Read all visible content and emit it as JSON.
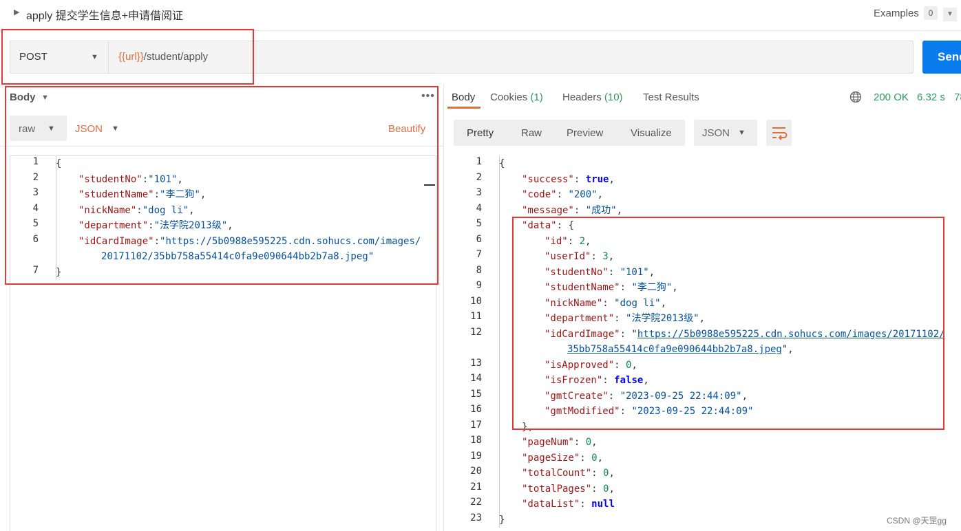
{
  "request": {
    "title": "apply 提交学生信息+申请借阅证",
    "examples_label": "Examples",
    "examples_count": "0",
    "method": "POST",
    "url_variable": "{{url}}",
    "url_path": "/student/apply",
    "send_label": "Send"
  },
  "body_panel": {
    "title": "Body",
    "mode": "raw",
    "format": "JSON",
    "beautify": "Beautify",
    "lines": [
      {
        "no": "1",
        "text": "{"
      },
      {
        "no": "2",
        "key": "\"studentNo\"",
        "sep": ":",
        "val": "\"101\"",
        "end": ","
      },
      {
        "no": "3",
        "key": "\"studentName\"",
        "sep": ":",
        "val": "\"李二狗\"",
        "end": ","
      },
      {
        "no": "4",
        "key": "\"nickName\"",
        "sep": ":",
        "val": "\"dog li\"",
        "end": ","
      },
      {
        "no": "5",
        "key": "\"department\"",
        "sep": ":",
        "val": "\"法学院2013级\"",
        "end": ","
      },
      {
        "no": "6",
        "key": "\"idCardImage\"",
        "sep": ":",
        "val": "\"https://5b0988e595225.cdn.sohucs.com/images/",
        "cont": "20171102/35bb758a55414c0fa9e090644bb2b7a8.jpeg\""
      },
      {
        "no": "7",
        "text": "}"
      }
    ]
  },
  "response": {
    "tabs": {
      "body": "Body",
      "cookies": "Cookies",
      "cookies_count": "(1)",
      "headers": "Headers",
      "headers_count": "(10)",
      "tests": "Test Results"
    },
    "status": "200 OK",
    "time": "6.32 s",
    "size_partial": "78",
    "view_tabs": [
      "Pretty",
      "Raw",
      "Preview",
      "Visualize"
    ],
    "format": "JSON",
    "line_numbers": [
      "1",
      "2",
      "3",
      "4",
      "5",
      "6",
      "7",
      "8",
      "9",
      "10",
      "11",
      "12",
      "13",
      "14",
      "15",
      "16",
      "17",
      "18",
      "19",
      "20",
      "21",
      "22",
      "23"
    ],
    "json": {
      "open": "{",
      "success_key": "\"success\"",
      "success_val": "true",
      "code_key": "\"code\"",
      "code_val": "\"200\"",
      "message_key": "\"message\"",
      "message_val": "\"成功\"",
      "data_key": "\"data\"",
      "data_open": "{",
      "id_key": "\"id\"",
      "id_val": "2",
      "userId_key": "\"userId\"",
      "userId_val": "3",
      "studentNo_key": "\"studentNo\"",
      "studentNo_val": "\"101\"",
      "studentName_key": "\"studentName\"",
      "studentName_val": "\"李二狗\"",
      "nickName_key": "\"nickName\"",
      "nickName_val": "\"dog li\"",
      "department_key": "\"department\"",
      "department_val": "\"法学院2013级\"",
      "idCardImage_key": "\"idCardImage\"",
      "idCardImage_link1": "https://5b0988e595225.cdn.sohucs.com/images/20171102/",
      "idCardImage_link2": "35bb758a55414c0fa9e090644bb2b7a8.jpeg",
      "isApproved_key": "\"isApproved\"",
      "isApproved_val": "0",
      "isFrozen_key": "\"isFrozen\"",
      "isFrozen_val": "false",
      "gmtCreate_key": "\"gmtCreate\"",
      "gmtCreate_val": "\"2023-09-25 22:44:09\"",
      "gmtModified_key": "\"gmtModified\"",
      "gmtModified_val": "\"2023-09-25 22:44:09\"",
      "data_close": "},",
      "pageNum_key": "\"pageNum\"",
      "pageNum_val": "0",
      "pageSize_key": "\"pageSize\"",
      "pageSize_val": "0",
      "totalCount_key": "\"totalCount\"",
      "totalCount_val": "0",
      "totalPages_key": "\"totalPages\"",
      "totalPages_val": "0",
      "dataList_key": "\"dataList\"",
      "dataList_val": "null",
      "close": "}"
    }
  },
  "watermark": "CSDN @天罡gg",
  "colors": {
    "accent_orange": "#e46d3e",
    "send_blue": "#097bed",
    "status_green": "#2d9c5b",
    "highlight_red": "#e53935"
  }
}
